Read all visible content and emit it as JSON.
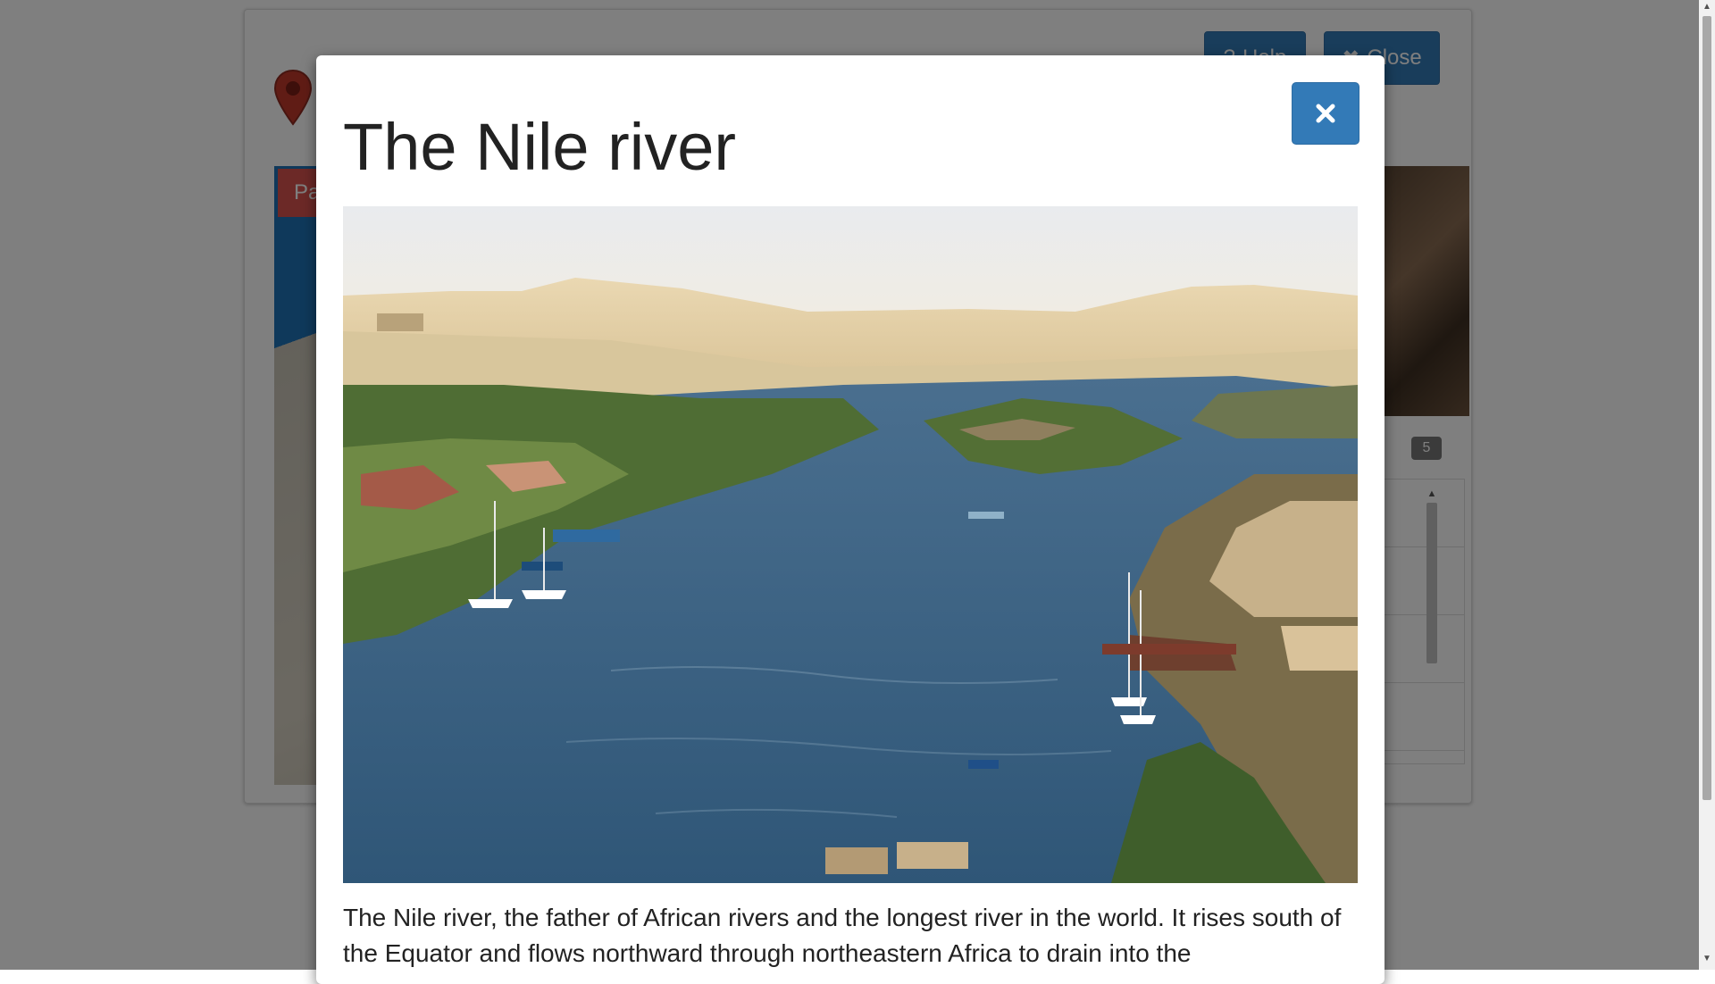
{
  "app": {
    "help_label": "Help",
    "close_label": "Close",
    "map_tag_label": "Pa",
    "count_badge": "5"
  },
  "modal": {
    "title": "The Nile river",
    "close_icon": "close-icon",
    "image_alt": "View of the Nile river with feluccas, islands and desert dunes",
    "description": "The Nile river, the father of African rivers and the longest river in the world. It rises south of the Equator and flows northward through northeastern Africa to drain into the"
  },
  "colors": {
    "primary": "#337ab7",
    "danger": "#d9534f",
    "badge": "#777777",
    "backdrop": "rgba(0,0,0,0.5)"
  }
}
